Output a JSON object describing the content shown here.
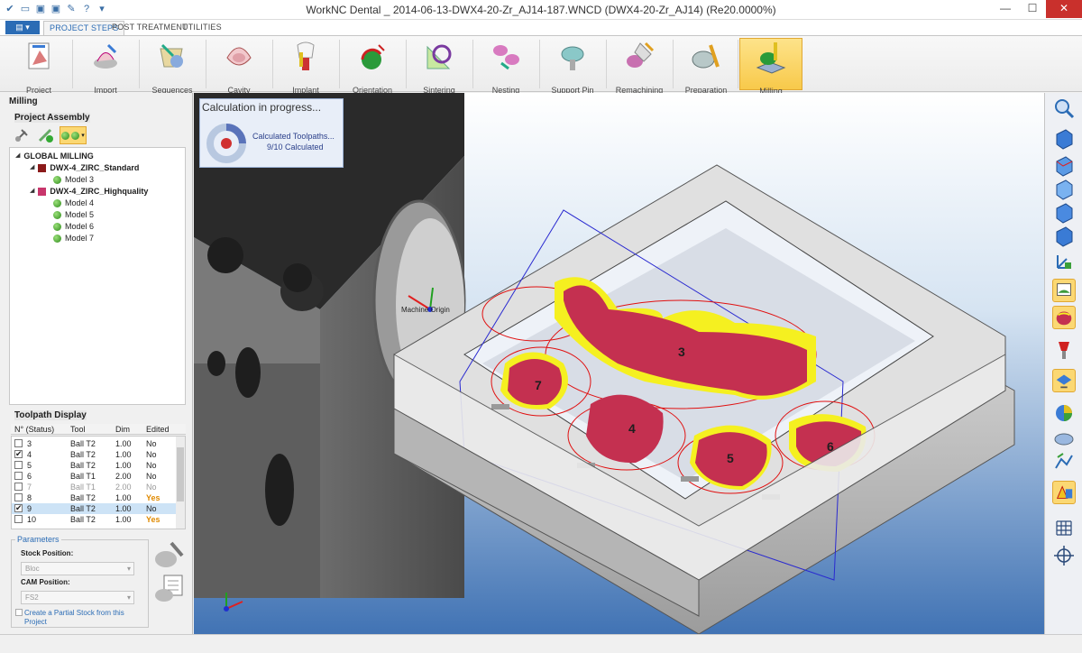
{
  "window": {
    "title": "WorkNC Dental _ 2014-06-13-DWX4-20-Zr_AJ14-187.WNCD (DWX4-20-Zr_AJ14) (Re20.0000%)",
    "minimize": "—",
    "maximize": "☐",
    "close": "✕"
  },
  "tabs": {
    "app_menu": "▤ ▾",
    "items": [
      "PROJECT STEPS",
      "POST TREATMENT",
      "UTILITIES"
    ]
  },
  "ribbon": {
    "buttons": [
      "Project",
      "Import",
      "Sequences",
      "Cavity",
      "Implant",
      "Orientation",
      "Sintering",
      "Nesting",
      "Support Pin",
      "Remachining",
      "Preparation",
      "Milling"
    ]
  },
  "left_panel": {
    "title": "Milling",
    "assembly_title": "Project Assembly",
    "tree": {
      "root": "GLOBAL MILLING",
      "groups": [
        {
          "name": "DWX-4_ZIRC_Standard",
          "color": "#8b1a1a",
          "models": [
            "Model 3"
          ]
        },
        {
          "name": "DWX-4_ZIRC_Highquality",
          "color": "#c8356b",
          "models": [
            "Model 4",
            "Model 5",
            "Model 6",
            "Model 7"
          ]
        }
      ]
    },
    "toolpath_title": "Toolpath Display",
    "toolpath_headers": [
      "N° (Status)",
      "Tool",
      "Dim",
      "Edited"
    ],
    "toolpaths": [
      {
        "n": "3",
        "checked": false,
        "tool": "Ball T2",
        "dim": "1.00",
        "edited": "No",
        "dim_state": "normal"
      },
      {
        "n": "4",
        "checked": true,
        "tool": "Ball T2",
        "dim": "1.00",
        "edited": "No",
        "dim_state": "normal"
      },
      {
        "n": "5",
        "checked": false,
        "tool": "Ball T2",
        "dim": "1.00",
        "edited": "No",
        "dim_state": "normal"
      },
      {
        "n": "6",
        "checked": false,
        "tool": "Ball T1",
        "dim": "2.00",
        "edited": "No",
        "dim_state": "normal"
      },
      {
        "n": "7",
        "checked": false,
        "tool": "Ball T1",
        "dim": "2.00",
        "edited": "No",
        "dim_state": "grey"
      },
      {
        "n": "8",
        "checked": false,
        "tool": "Ball T2",
        "dim": "1.00",
        "edited": "Yes",
        "dim_state": "normal"
      },
      {
        "n": "9",
        "checked": true,
        "tool": "Ball T2",
        "dim": "1.00",
        "edited": "No",
        "dim_state": "selected"
      },
      {
        "n": "10",
        "checked": false,
        "tool": "Ball T2",
        "dim": "1.00",
        "edited": "Yes",
        "dim_state": "normal"
      }
    ],
    "params": {
      "legend": "Parameters",
      "stock_label": "Stock Position:",
      "stock_value": "Bloc",
      "cam_label": "CAM Position:",
      "cam_value": "FS2",
      "partial_label_1": "Create a Partial Stock from this",
      "partial_label_2": "Project"
    }
  },
  "viewport": {
    "calc_title": "Calculation in progress...",
    "calc_line1": "Calculated Toolpaths...",
    "calc_line2": "9/10 Calculated",
    "machine_origin": "Machine Origin",
    "labels": [
      "3",
      "4",
      "5",
      "6",
      "7"
    ]
  },
  "colors": {
    "accent": "#2b6cb5",
    "active_ribbon": "#f8c94a",
    "toolpath_yellow": "#f5f020",
    "tooth_red": "#c43050",
    "boundary_red": "#e01010",
    "edited_yes": "#e08a00"
  }
}
